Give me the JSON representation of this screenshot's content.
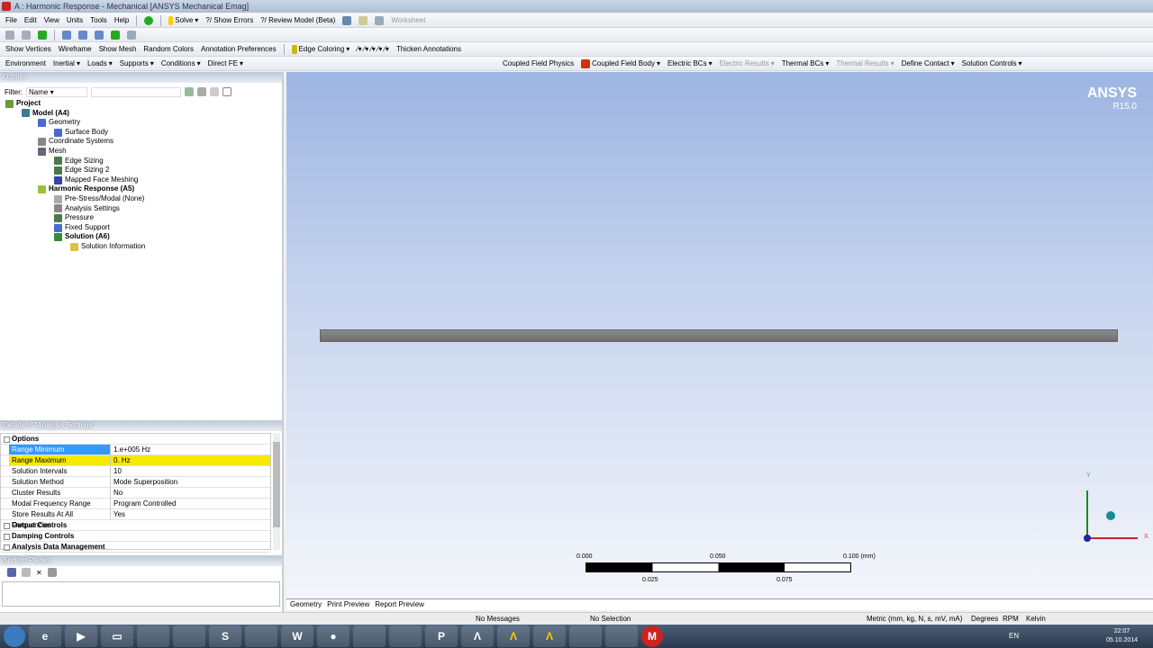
{
  "window": {
    "title": "A : Harmonic Response - Mechanical [ANSYS Mechanical Emag]"
  },
  "menu": [
    "File",
    "Edit",
    "View",
    "Units",
    "Tools",
    "Help"
  ],
  "toolbar1": {
    "solve": "Solve",
    "show_errors": "?/ Show Errors",
    "review_model": "?/ Review Model (Beta)",
    "worksheet": "Worksheet"
  },
  "toolbar3": {
    "show_vertices": "Show Vertices",
    "wireframe": "Wireframe",
    "show_mesh": "Show Mesh",
    "random_colors": "Random Colors",
    "annotation_prefs": "Annotation Preferences",
    "edge_coloring": "Edge Coloring",
    "thicken": "Thicken Annotations"
  },
  "toolbar4": {
    "environment": "Environment",
    "inertial": "Inertial",
    "loads": "Loads",
    "supports": "Supports",
    "conditions": "Conditions",
    "direct_fe": "Direct FE",
    "coupled_physics": "Coupled Field Physics",
    "coupled_body": "Coupled Field Body",
    "electric_bcs": "Electric BCs",
    "electric_results": "Electric Results",
    "thermal_bcs": "Thermal BCs",
    "thermal_results": "Thermal Results",
    "define_contact": "Define Contact",
    "solution_controls": "Solution Controls"
  },
  "outline": {
    "header": "Outline",
    "filter_label": "Filter:",
    "filter_value": "Name",
    "items": [
      {
        "label": "Project",
        "level": 0,
        "bold": true,
        "color": "#6a9a3a"
      },
      {
        "label": "Model (A4)",
        "level": 1,
        "bold": true,
        "color": "#3a7a8a"
      },
      {
        "label": "Geometry",
        "level": 2,
        "bold": false,
        "color": "#4a6ad0"
      },
      {
        "label": "Surface Body",
        "level": 3,
        "bold": false,
        "color": "#4a6ad0"
      },
      {
        "label": "Coordinate Systems",
        "level": 2,
        "bold": false,
        "color": "#888"
      },
      {
        "label": "Mesh",
        "level": 2,
        "bold": false,
        "color": "#667"
      },
      {
        "label": "Edge Sizing",
        "level": 3,
        "bold": false,
        "color": "#4a7a4a"
      },
      {
        "label": "Edge Sizing 2",
        "level": 3,
        "bold": false,
        "color": "#4a7a4a"
      },
      {
        "label": "Mapped Face Meshing",
        "level": 3,
        "bold": false,
        "color": "#3344aa"
      },
      {
        "label": "Harmonic Response (A5)",
        "level": 2,
        "bold": true,
        "color": "#9ac040"
      },
      {
        "label": "Pre-Stress/Modal (None)",
        "level": 3,
        "bold": false,
        "color": "#aaa"
      },
      {
        "label": "Analysis Settings",
        "level": 3,
        "bold": false,
        "color": "#888"
      },
      {
        "label": "Pressure",
        "level": 3,
        "bold": false,
        "color": "#4a7a4a"
      },
      {
        "label": "Fixed Support",
        "level": 3,
        "bold": false,
        "color": "#4a6ad0"
      },
      {
        "label": "Solution (A6)",
        "level": 3,
        "bold": true,
        "color": "#3a8a3a"
      },
      {
        "label": "Solution Information",
        "level": 4,
        "bold": false,
        "color": "#e0c040"
      }
    ]
  },
  "details": {
    "header": "Details of \"Analysis Settings\"",
    "group_options": "Options",
    "rows": [
      {
        "key": "Range Minimum",
        "value": "1.e+005 Hz",
        "state": "selected"
      },
      {
        "key": "Range Maximum",
        "value": "0. Hz",
        "state": "highlight"
      },
      {
        "key": "Solution Intervals",
        "value": "10",
        "state": ""
      },
      {
        "key": "Solution Method",
        "value": "Mode Superposition",
        "state": ""
      },
      {
        "key": "Cluster Results",
        "value": "No",
        "state": ""
      },
      {
        "key": "Modal Frequency Range",
        "value": "Program Controlled",
        "state": ""
      },
      {
        "key": "Store Results At All Frequencies",
        "value": "Yes",
        "state": ""
      }
    ],
    "groups": [
      "Output Controls",
      "Damping Controls",
      "Analysis Data Management"
    ]
  },
  "section_planes": {
    "header": "Section Planes"
  },
  "viewport": {
    "logo": "ANSYS",
    "version": "R15.0",
    "scale_top": [
      "0.000",
      "0.050",
      "0.100 (mm)"
    ],
    "scale_bottom": [
      "0.025",
      "0.075"
    ],
    "axis_y": "Y",
    "axis_x": "X"
  },
  "tabs": [
    "Geometry",
    "Print Preview",
    "Report Preview"
  ],
  "status": {
    "messages": "No Messages",
    "selection": "No Selection",
    "units": "Metric (mm, kg, N, s, mV, mA)",
    "angle": "Degrees",
    "speed": "RPM",
    "temp": "Kelvin"
  },
  "taskbar": {
    "lang": "EN",
    "time": "22:07",
    "date": "05.10.2014"
  }
}
